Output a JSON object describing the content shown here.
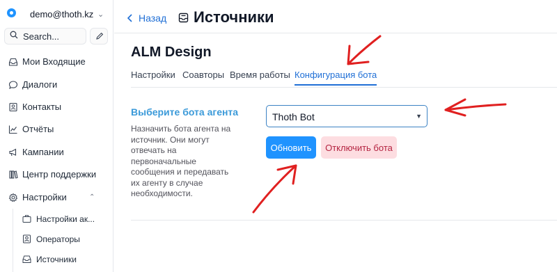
{
  "account": {
    "email": "demo@thoth.kz"
  },
  "search": {
    "label": "Search..."
  },
  "sidebar": {
    "items": [
      {
        "label": "Мои Входящие",
        "icon": "inbox-icon"
      },
      {
        "label": "Диалоги",
        "icon": "chat-bubble-icon"
      },
      {
        "label": "Контакты",
        "icon": "contact-card-icon"
      },
      {
        "label": "Отчёты",
        "icon": "chart-line-icon"
      },
      {
        "label": "Кампании",
        "icon": "megaphone-icon"
      },
      {
        "label": "Центр поддержки",
        "icon": "library-icon"
      },
      {
        "label": "Настройки",
        "icon": "gear-icon"
      }
    ],
    "subitems": [
      {
        "label": "Настройки ак...",
        "icon": "briefcase-icon"
      },
      {
        "label": "Операторы",
        "icon": "person-icon"
      },
      {
        "label": "Источники",
        "icon": "inbox-tray-icon"
      }
    ]
  },
  "header": {
    "back_label": "Назад",
    "title": "Источники"
  },
  "inbox": {
    "name": "ALM Design"
  },
  "tabs": [
    {
      "label": "Настройки"
    },
    {
      "label": "Соавторы"
    },
    {
      "label": "Время работы"
    },
    {
      "label": "Конфигурация бота",
      "active": true
    }
  ],
  "bot_section": {
    "title": "Выберите бота агента",
    "description": "Назначить бота агента на источник. Они могут отвечать на первоначальные сообщения и передавать их агенту в случае необходимости.",
    "selected_bot": "Thoth Bot",
    "update_label": "Обновить",
    "disconnect_label": "Отключить бота"
  },
  "colors": {
    "accent": "#1f93ff",
    "link": "#1f6fd6",
    "danger_bg": "#fddde1",
    "danger_text": "#b42340",
    "annotation": "#e02020"
  }
}
